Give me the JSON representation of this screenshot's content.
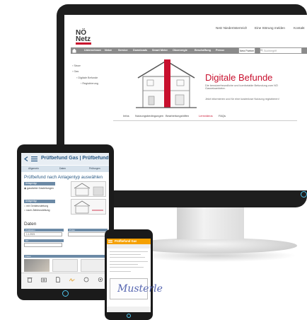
{
  "desktop": {
    "logo": "NÖ\nNetz",
    "utility_links": [
      "Netz Niederösterreich",
      "Eine Störung melden",
      "Kontakt"
    ],
    "nav_items": [
      "Unternehmen",
      "Netze",
      "Service",
      "Downloads",
      "Smart Meter",
      "Ökoenergie",
      "Beschaffung",
      "Presse"
    ],
    "nav_partner_button": "Netz Partner",
    "search_placeholder": "Suchbegriff",
    "sidebar": [
      "Strom",
      "Gas",
      "Digitale Befunde",
      "Registrierung"
    ],
    "hero_title": "Digitale Befunde",
    "hero_text_1": "Die benutzerfreundliche und komfortable Befundung zum NÖ Gasnetzanbieter.",
    "hero_text_2": "Jetzt informieren und für eine kostenlose Nutzung registrieren!",
    "tabs": [
      "Infos",
      "Nutzungsbedingungen",
      "Bearbeitungshilfen",
      "Lernvideos",
      "FAQs"
    ],
    "active_tab_index": 3,
    "accent_color": "#c8102e"
  },
  "tablet": {
    "title": "Prüfbefund Gas | Prüfbefund",
    "steps": [
      "Allgemein",
      "Daten",
      "Prüfungen"
    ],
    "heading": "Prüfbefund nach Anlagentyp auswählen",
    "box1_label": "Anlagentyp",
    "box1_option": "gasdichte Gasleitungen",
    "box2_label": "Anlagentyp",
    "box2_options": [
      "mit Gerätezuleitung",
      "nach Zählerzuleitung"
    ],
    "section": "Daten",
    "field_labels": [
      "Prüfdatum",
      "Prüfer"
    ],
    "field_values": [
      "1.1.2021",
      ""
    ],
    "field_label_3": "Ort",
    "footer_label": "Fotos",
    "accent_color": "#2a5a85"
  },
  "phone": {
    "title": "Prüfbefund Gas",
    "signature": "Musterle",
    "accent_color": "#f5a000"
  }
}
